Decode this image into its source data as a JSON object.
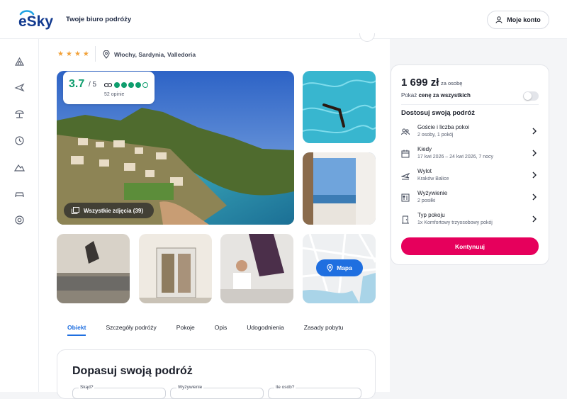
{
  "header": {
    "logo_text": "eSky",
    "tagline": "Twoje biuro podróży",
    "account_label": "Moje konto"
  },
  "sidebar": {
    "icons": [
      "camping-icon",
      "plane-icon",
      "beach-umbrella-icon",
      "clock-icon",
      "mountain-icon",
      "car-icon",
      "lifebuoy-icon"
    ]
  },
  "hotel": {
    "stars": 4,
    "location": "Włochy, Sardynia, Valledoria",
    "rating": {
      "score": "3.7",
      "max": "/ 5",
      "count_label": "52 opinie",
      "dots_filled": 4,
      "dots_total": 5
    },
    "all_photos_label": "Wszystkie zdjęcia (39)",
    "map_label": "Mapa"
  },
  "tabs": [
    "Obiekt",
    "Szczegóły podróży",
    "Pokoje",
    "Opis",
    "Udogodnienia",
    "Zasady pobytu"
  ],
  "active_tab": "Obiekt",
  "adjust": {
    "title": "Dopasuj swoją podróż",
    "fields": [
      "Skąd?",
      "Wyżywienie",
      "Ile osób?"
    ]
  },
  "booking": {
    "price": "1 699 zł",
    "per_person": "za osobę",
    "show_total_prefix": "Pokaż",
    "show_total_bold": "cenę za wszystkich",
    "section_title": "Dostosuj swoją podróż",
    "options": [
      {
        "title": "Goście i liczba pokoi",
        "sub": "2 osoby, 1 pokój",
        "icon": "users-icon"
      },
      {
        "title": "Kiedy",
        "sub": "17 kwi 2026 – 24 kwi 2026, 7 nocy",
        "icon": "calendar-icon"
      },
      {
        "title": "Wylot",
        "sub": "Kraków Balice",
        "icon": "departure-plane-icon"
      },
      {
        "title": "Wyżywienie",
        "sub": "2 posiłki",
        "icon": "food-icon"
      },
      {
        "title": "Typ pokoju",
        "sub": "1x Komfortowy trzyosobowy pokój",
        "icon": "door-icon"
      }
    ],
    "continue_label": "Kontynuuj"
  },
  "colors": {
    "brand_blue": "#1f6fe0",
    "rating_green": "#0f9e6e",
    "cta_pink": "#e6005c",
    "star_orange": "#f2a23a"
  }
}
